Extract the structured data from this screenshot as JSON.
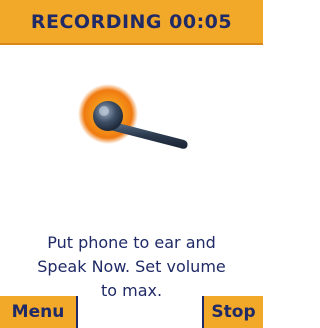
{
  "header": {
    "title": "RECORDING 00:05"
  },
  "icon": {
    "name": "microphone-icon",
    "glow_color": "#f07a10",
    "mic_color": "#2b3a4e"
  },
  "prompt": {
    "line1": "Put phone to ear and",
    "line2": "Speak Now. Set volume",
    "line3": "to max."
  },
  "softkeys": {
    "left_label": "Menu",
    "right_label": "Stop"
  },
  "colors": {
    "accent": "#f2a92a",
    "text": "#1f2a66",
    "background": "#ffffff"
  }
}
